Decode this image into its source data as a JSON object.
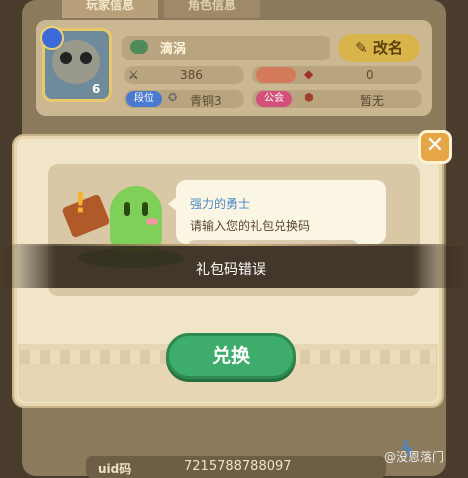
{
  "tabs": [
    "玩家信息",
    "角色信息"
  ],
  "profile": {
    "level": "6",
    "name": "滴涡",
    "rename_label": "改名",
    "stats": [
      {
        "value": "386"
      },
      {
        "label": "",
        "value": "0"
      },
      {
        "label": "段位",
        "value": "青铜3"
      },
      {
        "label": "公会",
        "value": "暂无"
      }
    ],
    "uid_label": "uid码",
    "uid_value": "7215788788097"
  },
  "dialog": {
    "speaker": "强力的勇士",
    "prompt": "请输入您的礼包兑换码",
    "redeem_label": "兑换",
    "close_glyph": "✕"
  },
  "toast": "礼包码错误",
  "watermark": "@没恩落门",
  "colors": {
    "accent_green": "#3eac6a",
    "close_orange": "#e6a546",
    "rename_gold": "#d8b44a"
  }
}
